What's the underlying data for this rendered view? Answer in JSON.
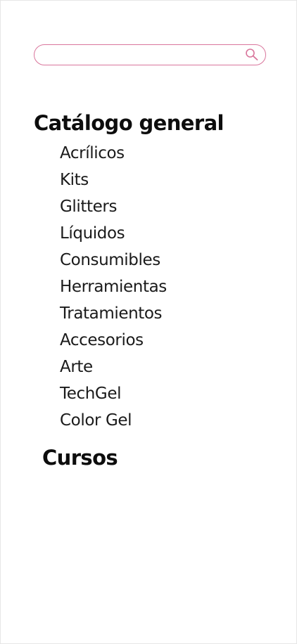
{
  "search": {
    "value": "",
    "placeholder": "",
    "icon": "search-icon",
    "border_color": "#d9769c"
  },
  "catalog": {
    "title": "Catálogo general",
    "items": [
      {
        "label": "Acrílicos"
      },
      {
        "label": "Kits"
      },
      {
        "label": "Glitters"
      },
      {
        "label": "Líquidos"
      },
      {
        "label": "Consumibles"
      },
      {
        "label": "Herramientas"
      },
      {
        "label": "Tratamientos"
      },
      {
        "label": "Accesorios"
      },
      {
        "label": "Arte"
      },
      {
        "label": "TechGel"
      },
      {
        "label": "Color Gel"
      }
    ]
  },
  "courses": {
    "title": "Cursos"
  }
}
